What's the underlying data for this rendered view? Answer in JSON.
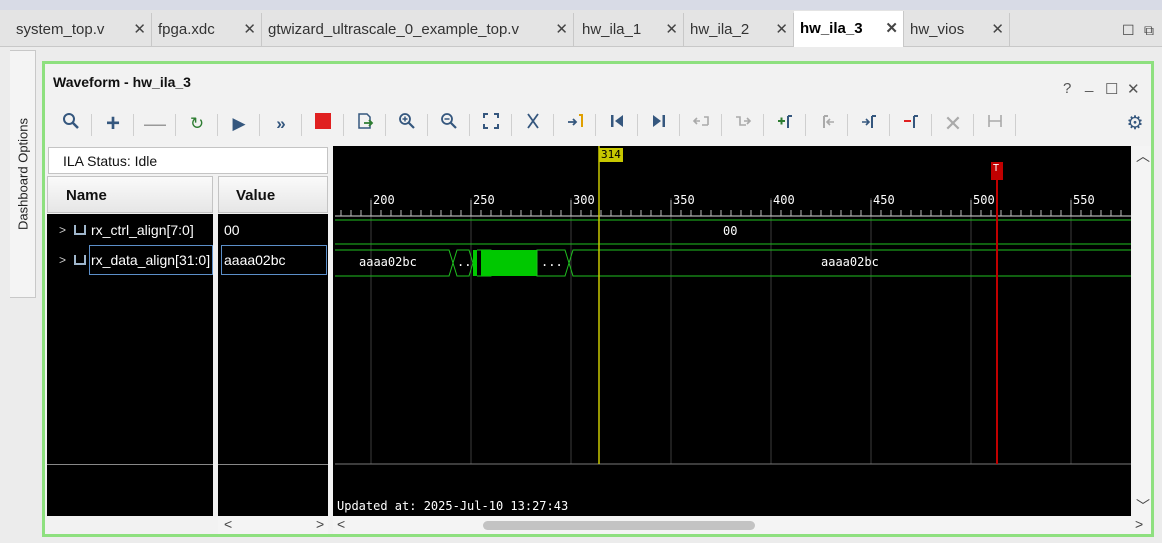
{
  "tabs": [
    {
      "label": "system_top.v",
      "active": false
    },
    {
      "label": "fpga.xdc",
      "active": false
    },
    {
      "label": "gtwizard_ultrascale_0_example_top.v",
      "active": false
    },
    {
      "label": "hw_ila_1",
      "active": false
    },
    {
      "label": "hw_ila_2",
      "active": false
    },
    {
      "label": "hw_ila_3",
      "active": true
    },
    {
      "label": "hw_vios",
      "active": false
    }
  ],
  "dashboard_options": "Dashboard Options",
  "panel": {
    "title": "Waveform - hw_ila_3",
    "status": "ILA Status:  Idle"
  },
  "columns": {
    "name": "Name",
    "value": "Value"
  },
  "signals": [
    {
      "name": "rx_ctrl_align[7:0]",
      "value": "00"
    },
    {
      "name": "rx_data_align[31:0]",
      "value": "aaaa02bc"
    }
  ],
  "waveform": {
    "ruler": [
      "200",
      "250",
      "300",
      "350",
      "400",
      "450",
      "500",
      "550"
    ],
    "cursor_label": "314",
    "trigger_label": "T",
    "ctrl_value": "00",
    "data_segments": [
      "aaaa02bc",
      "..",
      "...",
      "aaaa02bc"
    ],
    "updated": "Updated at: 2025-Jul-10 13:27:43"
  },
  "colors": {
    "accent_border": "#8ee07f",
    "wave_green": "#00c800",
    "cursor_yellow": "#c8c800",
    "trigger_red": "#c00000"
  },
  "toolbar_icons": [
    "search-icon",
    "add-icon",
    "remove-icon",
    "run-trigger-immediate-icon",
    "run-icon",
    "run-repeat-icon",
    "stop-icon",
    "export-icon",
    "zoom-in-icon",
    "zoom-out-icon",
    "zoom-fit-icon",
    "cursor-icon",
    "go-to-time-icon",
    "previous-edge-icon",
    "next-edge-icon",
    "previous-transition-icon",
    "next-transition-icon",
    "add-marker-icon",
    "previous-marker-icon",
    "next-marker-icon",
    "delete-marker-icon",
    "delete-all-icon",
    "swap-cursors-icon",
    "settings-icon"
  ]
}
